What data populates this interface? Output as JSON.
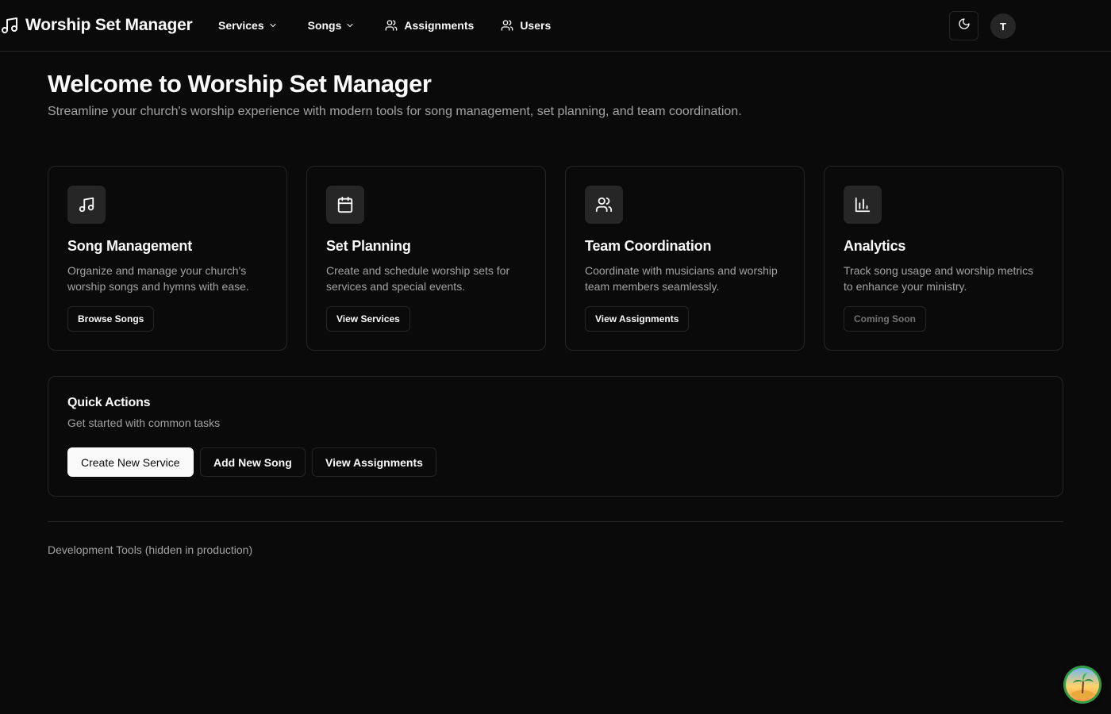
{
  "app": {
    "title": "Worship Set Manager"
  },
  "nav": {
    "services": "Services",
    "songs": "Songs",
    "assignments": "Assignments",
    "users": "Users"
  },
  "header": {
    "avatar_initial": "T"
  },
  "hero": {
    "title": "Welcome to Worship Set Manager",
    "subtitle": "Streamline your church's worship experience with modern tools for song management, set planning, and team coordination."
  },
  "features": [
    {
      "icon": "music-icon",
      "title": "Song Management",
      "description": "Organize and manage your church's worship songs and hymns with ease.",
      "button": "Browse Songs"
    },
    {
      "icon": "calendar-icon",
      "title": "Set Planning",
      "description": "Create and schedule worship sets for services and special events.",
      "button": "View Services"
    },
    {
      "icon": "users-icon",
      "title": "Team Coordination",
      "description": "Coordinate with musicians and worship team members seamlessly.",
      "button": "View Assignments"
    },
    {
      "icon": "bar-chart-icon",
      "title": "Analytics",
      "description": "Track song usage and worship metrics to enhance your ministry.",
      "button": "Coming Soon"
    }
  ],
  "quick_actions": {
    "title": "Quick Actions",
    "subtitle": "Get started with common tasks",
    "buttons": [
      "Create New Service",
      "Add New Song",
      "View Assignments"
    ]
  },
  "footer": {
    "dev_tools": "Development Tools (hidden in production)"
  },
  "colors": {
    "background": "#0a0a0a",
    "border": "#262626",
    "muted_text": "#a3a3a3",
    "foreground": "#fafafa"
  }
}
